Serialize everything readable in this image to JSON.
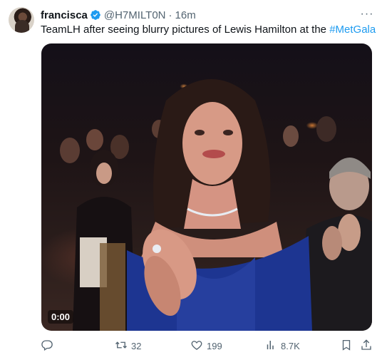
{
  "tweet": {
    "author_name": "francisca",
    "handle": "@H7MILT0N",
    "separator": "·",
    "time": "16m",
    "text": "TeamLH after seeing blurry pictures of Lewis Hamilton at the ",
    "hashtag": "#MetGala",
    "more_label": "···",
    "avatar_icon": "avatar-photo",
    "verified_icon": "verified-badge-icon",
    "accent_color": "#1d9bf0"
  },
  "media": {
    "type": "video",
    "timecode": "0:00"
  },
  "actions": {
    "reply_icon": "reply-icon",
    "retweet_icon": "retweet-icon",
    "retweet_count": "32",
    "like_icon": "heart-icon",
    "like_count": "199",
    "views_icon": "views-bar-icon",
    "views_count": "8.7K",
    "bookmark_icon": "bookmark-icon",
    "share_icon": "share-icon"
  }
}
